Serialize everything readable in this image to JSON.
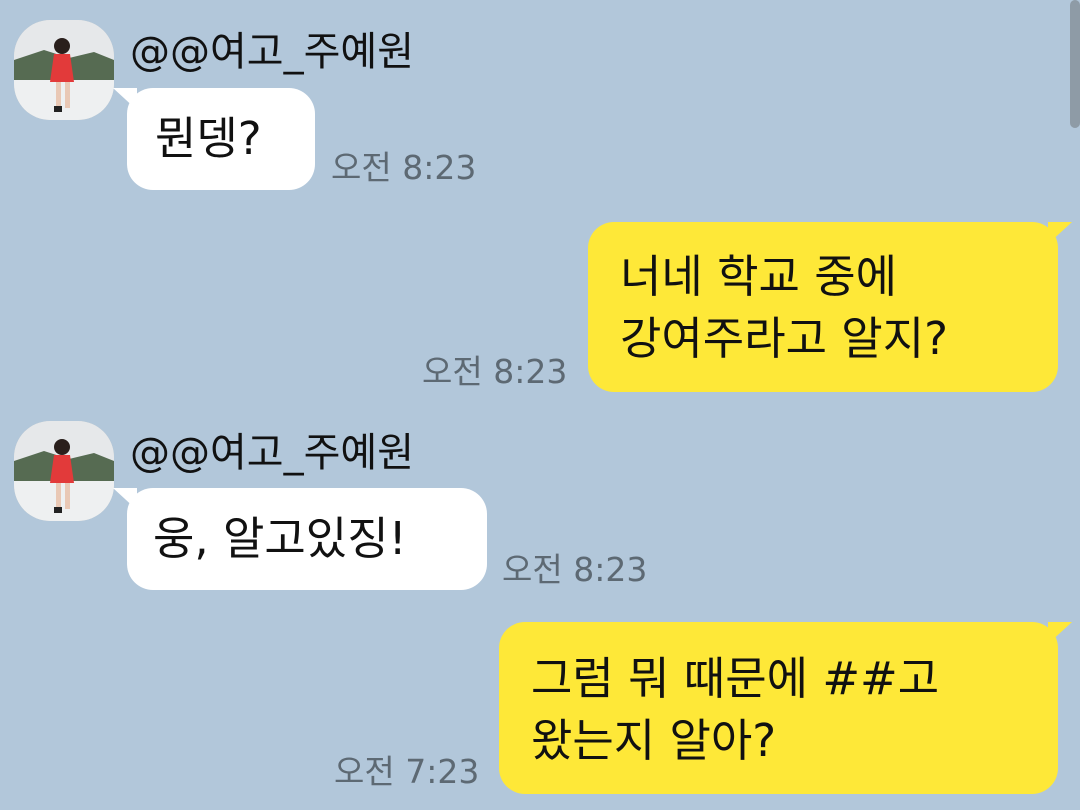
{
  "messages": [
    {
      "direction": "incoming",
      "sender": "@@여고_주예원",
      "lines": [
        "뭔뎅?"
      ],
      "time": "오전 8:23"
    },
    {
      "direction": "outgoing",
      "lines": [
        "너네 학교 중에",
        "강여주라고 알지?"
      ],
      "time": "오전 8:23"
    },
    {
      "direction": "incoming",
      "sender": "@@여고_주예원",
      "lines": [
        "웅, 알고있징!"
      ],
      "time": "오전 8:23"
    },
    {
      "direction": "outgoing",
      "lines": [
        "그럼 뭐 때문에 ##고",
        "왔는지 알아?"
      ],
      "time": "오전 7:23"
    }
  ],
  "colors": {
    "background": "#b2c7da",
    "incoming_bubble": "#ffffff",
    "outgoing_bubble": "#fee838",
    "timestamp": "#5d6973"
  },
  "icons": {
    "avatar": "profile-photo"
  }
}
